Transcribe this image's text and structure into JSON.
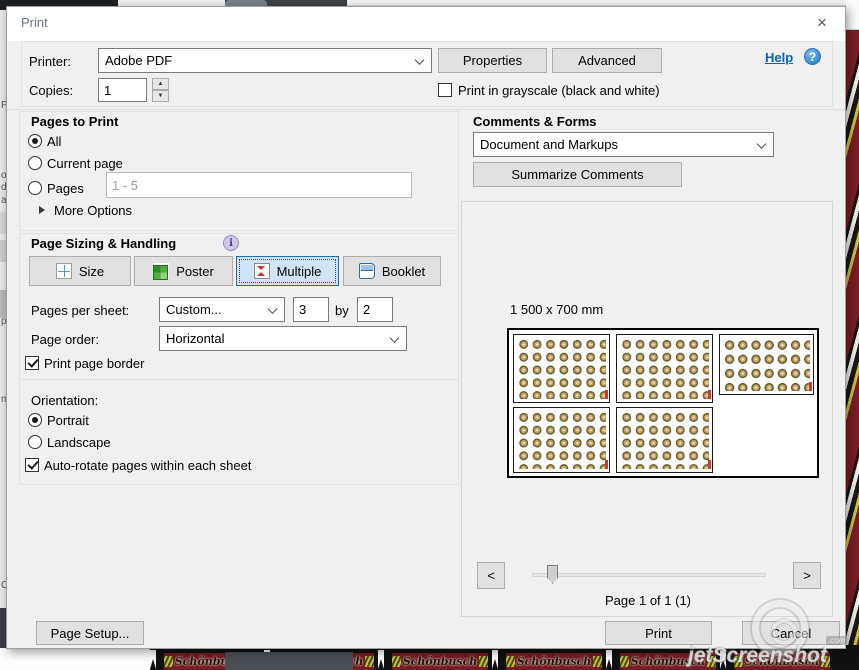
{
  "dialog": {
    "title": "Print",
    "close": "×"
  },
  "printer": {
    "label": "Printer:",
    "value": "Adobe PDF",
    "properties": "Properties",
    "advanced": "Advanced",
    "help": "Help",
    "help_q": "?",
    "copies_label": "Copies:",
    "copies_value": "1",
    "grayscale_label": "Print in grayscale (black and white)"
  },
  "pages_to_print": {
    "header": "Pages to Print",
    "all": "All",
    "current": "Current page",
    "pages": "Pages",
    "pages_value": "1 - 5",
    "more_options": "More Options"
  },
  "sizing": {
    "header": "Page Sizing & Handling",
    "info": "i",
    "size_btn": "Size",
    "poster_btn": "Poster",
    "multiple_btn": "Multiple",
    "booklet_btn": "Booklet",
    "pages_per_sheet_label": "Pages per sheet:",
    "pages_per_sheet_value": "Custom...",
    "grid_x": "3",
    "by": "by",
    "grid_y": "2",
    "page_order_label": "Page order:",
    "page_order_value": "Horizontal",
    "print_border_label": "Print page border"
  },
  "orientation": {
    "header": "Orientation:",
    "portrait": "Portrait",
    "landscape": "Landscape",
    "auto_rotate": "Auto-rotate pages within each sheet"
  },
  "comments": {
    "header": "Comments & Forms",
    "value": "Document and Markups",
    "summarize": "Summarize Comments"
  },
  "preview": {
    "size_label": "1 500 x 700 mm",
    "page_counter": "Page 1 of 1 (1)",
    "prev": "<",
    "next": ">",
    "pages_on_sheet": 5,
    "grid": "3 by 2"
  },
  "footer": {
    "page_setup": "Page Setup...",
    "print": "Print",
    "cancel": "Cancel"
  },
  "background": {
    "label_text": "Schönbusch",
    "watermark": "jetScreenshot",
    "watermark_com": ".com",
    "left_fragments": {
      "0": "P",
      "1": "ob",
      "2": "d",
      "3": "a",
      "4": "pe",
      "5": "me",
      "6": "C"
    }
  },
  "colors": {
    "selected_btn_bg": "#cfe4f7",
    "selected_btn_border": "#1f6cb5",
    "link_blue": "#0563c1",
    "label_red": "#7a1c24",
    "dialog_bg": "#f0f0f0"
  }
}
